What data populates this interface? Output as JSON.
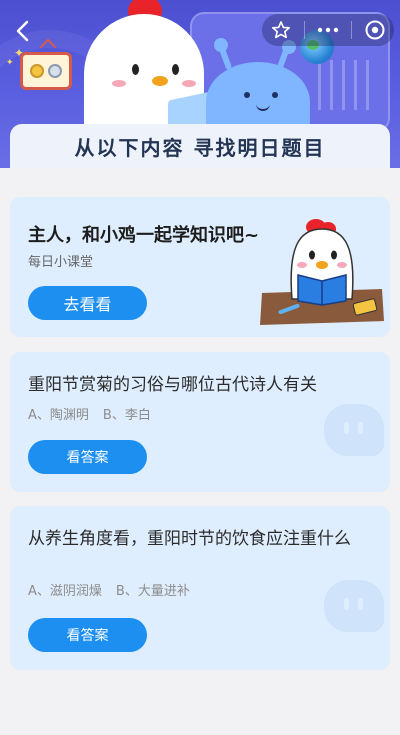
{
  "header": {
    "banner_title": "从以下内容 寻找明日题目",
    "icons": [
      "back-icon",
      "star-icon",
      "more-icon",
      "target-icon"
    ]
  },
  "lesson_card": {
    "title": "主人，和小鸡一起学知识吧~",
    "subtitle": "每日小课堂",
    "button_label": "去看看"
  },
  "questions": [
    {
      "question": "重阳节赏菊的习俗与哪位古代诗人有关",
      "option_a": "A、陶渊明",
      "option_b": "B、李白",
      "button_label": "看答案"
    },
    {
      "question": "从养生角度看，重阳时节的饮食应注重什么",
      "option_a": "A、滋阴润燥",
      "option_b": "B、大量进补",
      "button_label": "看答案"
    }
  ],
  "colors": {
    "header_bg": "#5a5fe0",
    "card_bg": "#dfeefe",
    "button": "#1c8ff0",
    "page_bg": "#f2f2f4"
  }
}
